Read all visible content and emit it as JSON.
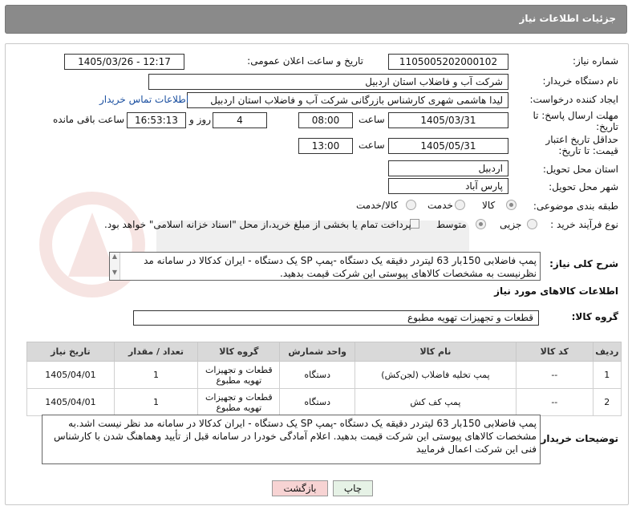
{
  "header": {
    "title": "جزئیات اطلاعات نیاز"
  },
  "fields": {
    "need_number_label": "شماره نیاز:",
    "need_number": "1105005202000102",
    "announce_label": "تاریخ و ساعت اعلان عمومی:",
    "announce_value": "1405/03/26 - 12:17",
    "buyer_label": "نام دستگاه خریدار:",
    "buyer_value": "شرکت آب و فاضلاب استان اردبیل",
    "creator_label": "ایجاد کننده درخواست:",
    "creator_value": "لیدا  هاشمی شهری کارشناس بازرگانی شرکت آب و فاضلاب استان اردبیل",
    "contact_link": "اطلاعات تماس خریدار",
    "deadline_label": "مهلت ارسال پاسخ: تا تاریخ:",
    "deadline_date": "1405/03/31",
    "time_label": "ساعت",
    "deadline_time": "08:00",
    "days_value": "4",
    "days_label": "روز و",
    "remaining_time": "16:53:13",
    "remaining_label": "ساعت باقی مانده",
    "validity_label": "حداقل تاریخ اعتبار قیمت: تا تاریخ:",
    "validity_date": "1405/05/31",
    "validity_time": "13:00",
    "province_label": "استان محل تحویل:",
    "province_value": "اردبیل",
    "city_label": "شهر محل تحویل:",
    "city_value": "پارس آباد",
    "category_label": "طبقه بندی موضوعی:",
    "category_options": [
      "کالا",
      "خدمت",
      "کالا/خدمت"
    ],
    "category_selected": "کالا",
    "process_label": "نوع فرآیند خرید :",
    "process_options": [
      "جزیی",
      "متوسط"
    ],
    "process_selected": "متوسط",
    "payment_note": "پرداخت تمام یا بخشی از مبلغ خرید،از محل \"اسناد خزانه اسلامی\" خواهد بود."
  },
  "summary": {
    "label": "شرح کلی نیاز:",
    "text": "پمپ فاضلابی  150بار  63 لیتردر دقیقه  یک دستگاه -پمپ  SP یک دستگاه - ایران کدکالا در سامانه مد نظرنیست به مشخصات کالاهای پیوستی این شرکت قیمت بدهید."
  },
  "goods": {
    "section_title": "اطلاعات کالاهای مورد نیاز",
    "group_label": "گروه کالا:",
    "group_value": "قطعات و تجهیزات تهویه مطبوع",
    "columns": [
      "ردیف",
      "کد کالا",
      "نام کالا",
      "واحد شمارش",
      "گروه کالا",
      "تعداد / مقدار",
      "تاریخ نیاز"
    ],
    "rows": [
      {
        "idx": "1",
        "code": "--",
        "name": "پمپ تخلیه فاضلاب (لجن‌کش)",
        "unit": "دستگاه",
        "group": "قطعات و تجهیزات تهویه مطبوع",
        "qty": "1",
        "date": "1405/04/01"
      },
      {
        "idx": "2",
        "code": "--",
        "name": "پمپ کف کش",
        "unit": "دستگاه",
        "group": "قطعات و تجهیزات تهویه مطبوع",
        "qty": "1",
        "date": "1405/04/01"
      }
    ]
  },
  "buyer_notes": {
    "label": "توضیحات خریدار:",
    "text": "پمپ فاضلابی  150بار  63 لیتردر دقیقه  یک دستگاه -پمپ  SP یک دستگاه - ایران کدکالا در سامانه مد نظر نیست اشد.به مشخصات کالاهای پیوستی این شرکت قیمت بدهید. اعلام آمادگی خودرا در سامانه  قبل از تأیید وهماهنگ شدن با کارشناس فنی این شرکت اعمال فرمایید"
  },
  "buttons": {
    "print": "چاپ",
    "back": "بازگشت"
  },
  "colors": {
    "header": "#8a8a8a",
    "table_header": "#d9d9d9",
    "back_button": "#f7d3d3",
    "print_button": "#e6f2e6",
    "link": "#1a4fa0"
  }
}
